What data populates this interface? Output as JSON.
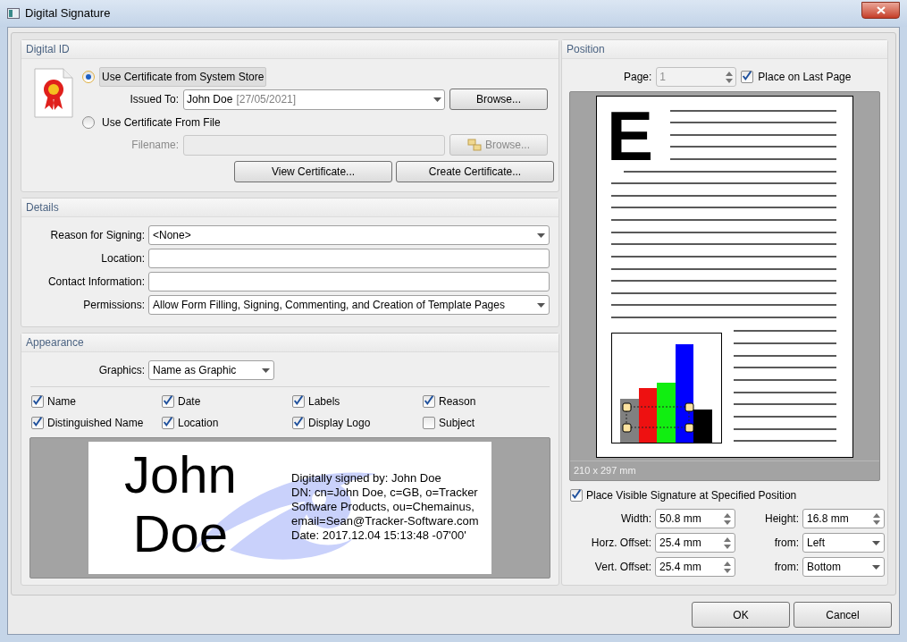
{
  "window": {
    "title": "Digital Signature"
  },
  "digital_id": {
    "title": "Digital ID",
    "sources": [
      {
        "label": "Use Certificate from System Store",
        "selected": true
      },
      {
        "label": "Use Certificate From File",
        "selected": false
      }
    ],
    "issued_to": {
      "label": "Issued To:",
      "value": "John Doe",
      "date": "[27/05/2021]",
      "button": "Browse..."
    },
    "filename": {
      "label": "Filename:",
      "disabled": true,
      "button": "Browse..."
    },
    "buttons": [
      "View Certificate...",
      "Create Certificate..."
    ]
  },
  "details": {
    "title": "Details",
    "fields": [
      {
        "kind": "combo",
        "label": "Reason for Signing:",
        "value": "<None>"
      },
      {
        "kind": "text",
        "label": "Location:"
      },
      {
        "kind": "text",
        "label": "Contact Information:"
      },
      {
        "kind": "combo",
        "label": "Permissions:",
        "value": "Allow Form Filling, Signing, Commenting, and Creation of Template Pages"
      }
    ]
  },
  "appearance": {
    "title": "Appearance",
    "graphics": {
      "label": "Graphics:",
      "value": "Name as Graphic"
    },
    "options": [
      {
        "label": "Name",
        "checked": true
      },
      {
        "label": "Date",
        "checked": true
      },
      {
        "label": "Labels",
        "checked": true
      },
      {
        "label": "Reason",
        "checked": true
      },
      {
        "label": "Distinguished Name",
        "checked": true
      },
      {
        "label": "Location",
        "checked": true
      },
      {
        "label": "Display Logo",
        "checked": true
      },
      {
        "label": "Subject",
        "checked": false
      }
    ],
    "preview": {
      "name_lines": [
        "John",
        "Doe"
      ],
      "info_lines": [
        "Digitally signed by: John Doe",
        "DN: cn=John Doe, c=GB, o=Tracker",
        "Software Products, ou=Chemainus,",
        "email=Sean@Tracker-Software.com",
        "Date: 2017.12.04 15:13:48 -07'00'"
      ]
    }
  },
  "position": {
    "title": "Position",
    "page": {
      "label": "Page:",
      "value": "1",
      "disabled": true
    },
    "last_page": {
      "label": "Place on Last Page",
      "checked": true
    },
    "preview": {
      "letter": "E",
      "page_size": "210 x 297 mm"
    },
    "place_visible": {
      "label": "Place Visible Signature at Specified Position",
      "checked": true
    },
    "fields": [
      {
        "kind": "spin",
        "label": "Width:",
        "value": "50.8 mm"
      },
      {
        "kind": "spin",
        "label": "Height:",
        "value": "16.8 mm"
      },
      {
        "kind": "spin",
        "label": "Horz. Offset:",
        "value": "25.4 mm"
      },
      {
        "kind": "combo",
        "label": "from:",
        "value": "Left"
      },
      {
        "kind": "spin",
        "label": "Vert. Offset:",
        "value": "25.4 mm"
      },
      {
        "kind": "combo",
        "label": "from:",
        "value": "Bottom"
      }
    ]
  },
  "buttons": [
    "OK",
    "Cancel"
  ]
}
